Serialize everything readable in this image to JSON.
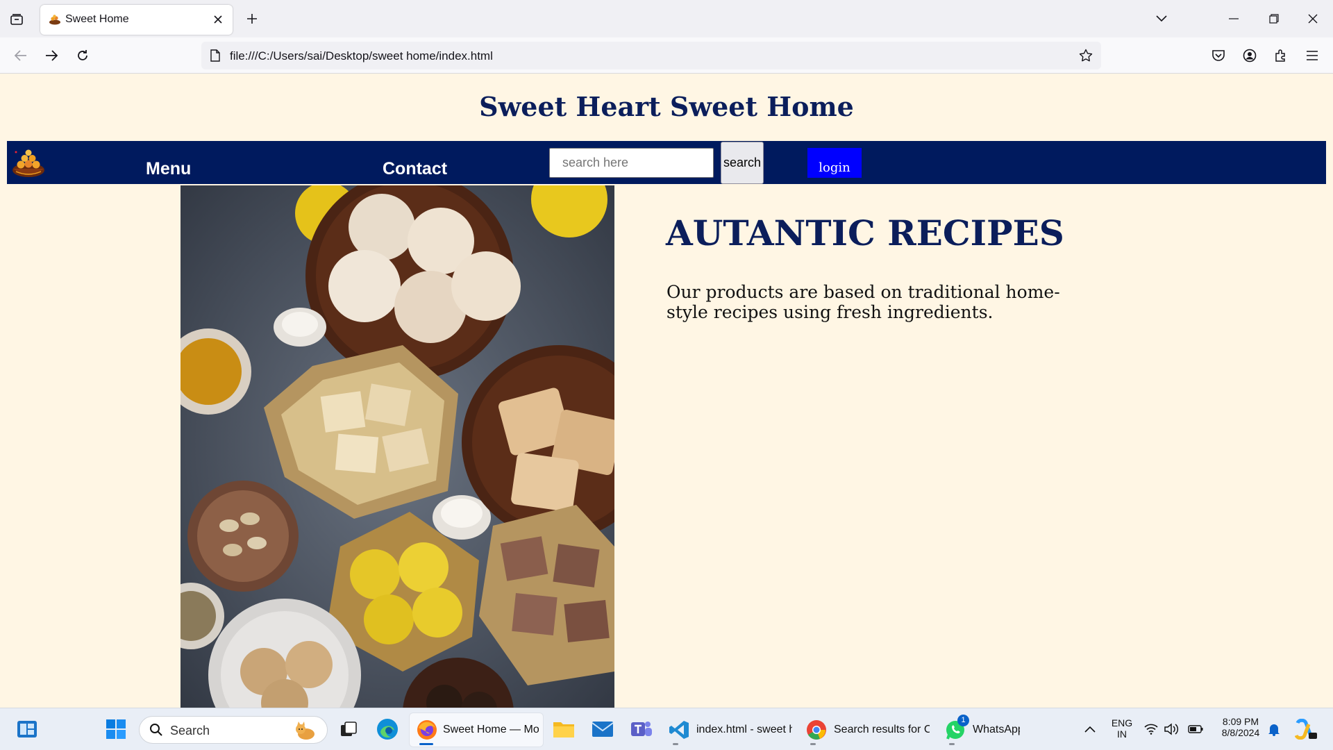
{
  "browser": {
    "tab": {
      "title": "Sweet Home"
    },
    "url": "file:///C:/Users/sai/Desktop/sweet home/index.html"
  },
  "site": {
    "title": "Sweet Heart Sweet Home",
    "nav": {
      "menu_label": "Menu",
      "contact_label": "Contact",
      "search_placeholder": "search here",
      "search_button": "search",
      "login_button": "login"
    },
    "hero": {
      "heading": "AUTANTIC RECIPES",
      "text": "Our products are based on traditional home-style recipes using fresh ingredients."
    }
  },
  "taskbar": {
    "search_label": "Search",
    "apps": [
      {
        "label": "Sweet Home — Mozilla Firefox"
      },
      {
        "label": "index.html - sweet home"
      },
      {
        "label": "Search results for Co"
      },
      {
        "label": "WhatsApp"
      }
    ],
    "whatsapp_badge": "1",
    "lang_top": "ENG",
    "lang_bottom": "IN",
    "time": "8:09 PM",
    "date": "8/8/2024"
  },
  "colors": {
    "page_bg": "#fff6e4",
    "nav_bg": "#001a5e",
    "title_color": "#0b1e5b",
    "login_bg": "#0000ff"
  }
}
